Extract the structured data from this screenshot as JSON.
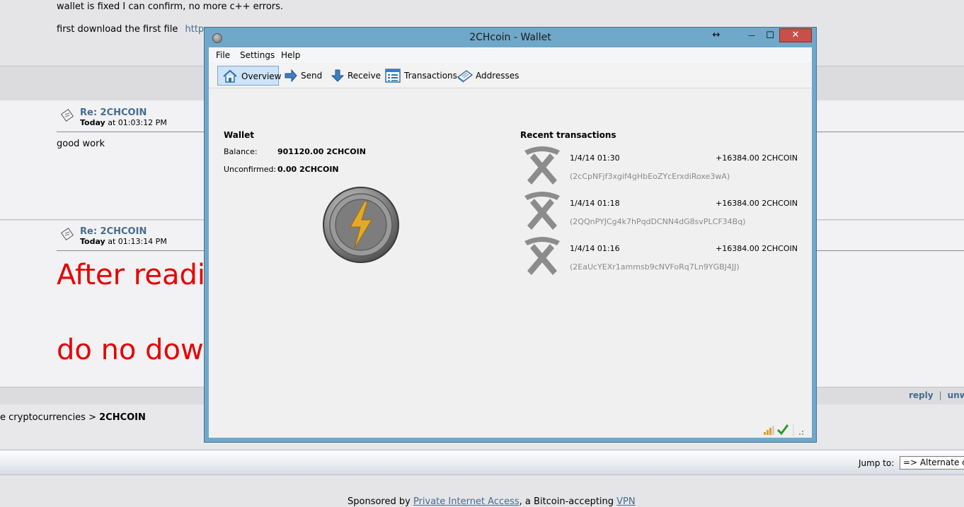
{
  "forum": {
    "line1": "wallet is fixed I can confirm, no more c++ errors.",
    "line2_text": "first download the first file",
    "line2_link": "http",
    "posts": [
      {
        "title": "Re: 2CHCOIN",
        "day": "Today",
        "time": " at 01:03:12 PM",
        "body": "good work"
      },
      {
        "title": "Re: 2CHCOIN",
        "day": "Today",
        "time": " at 01:13:14 PM",
        "body_big1": "After readi",
        "body_big2": "do no dow"
      }
    ],
    "links": {
      "reply": "reply",
      "sep": "|",
      "unwatch": "unw"
    },
    "breadcrumb": {
      "prefix": "e cryptocurrencies > ",
      "current": "2CHCOIN"
    },
    "jump": {
      "label": "Jump to:",
      "selected": "=> Alternate c"
    },
    "sponsor": {
      "text1": "Sponsored by ",
      "link1": "Private Internet Access",
      "text2": ", a Bitcoin-accepting ",
      "link2": "VPN"
    }
  },
  "window": {
    "title": "2CHcoin - Wallet",
    "controls": {
      "resize": "↔",
      "minimize": "—",
      "maximize": "☐",
      "close": "✕"
    },
    "menu": [
      "File",
      "Settings",
      "Help"
    ],
    "toolbar": [
      {
        "label": "Overview",
        "icon": "home-icon",
        "active": true
      },
      {
        "label": "Send",
        "icon": "send-arrow-icon"
      },
      {
        "label": "Receive",
        "icon": "receive-arrow-icon"
      },
      {
        "label": "Transactions",
        "icon": "transactions-list-icon"
      },
      {
        "label": "Addresses",
        "icon": "address-book-icon"
      }
    ],
    "wallet": {
      "heading": "Wallet",
      "balance_label": "Balance:",
      "balance_value": "901120.00 2CHCOIN",
      "unconfirmed_label": "Unconfirmed:",
      "unconfirmed_value": "0.00 2CHCOIN"
    },
    "recent": {
      "heading": "Recent transactions",
      "items": [
        {
          "date": "1/4/14 01:30",
          "amount": "+16384.00 2CHCOIN",
          "address": "(2cCpNFjf3xgif4gHbEoZYcErxdiRoxe3wA)"
        },
        {
          "date": "1/4/14 01:18",
          "amount": "+16384.00 2CHCOIN",
          "address": "(2QQnPYJCg4k7hPqdDCNN4dG8svPLCF34Bq)"
        },
        {
          "date": "1/4/14 01:16",
          "amount": "+16384.00 2CHCOIN",
          "address": "(2EaUcYEXr1ammsb9cNVFoRq7Ln9YGBJ4JJ)"
        }
      ]
    },
    "colors": {
      "accent": "#cde3f7",
      "frame": "#6fa8c9",
      "close": "#c7504b",
      "coin_bolt": "#e3a92a"
    }
  }
}
